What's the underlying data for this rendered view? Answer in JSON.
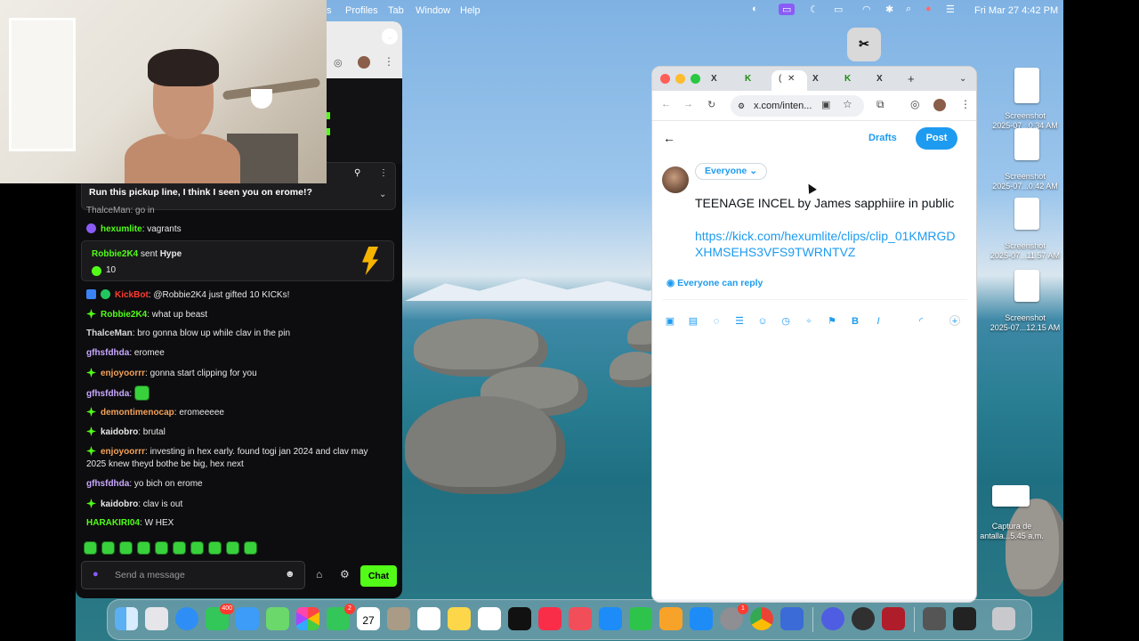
{
  "menubar": {
    "menus": [
      "s",
      "Profiles",
      "Tab",
      "Window",
      "Help"
    ],
    "datetime": "Fri Mar 27  4:42 PM"
  },
  "chat": {
    "pinned_message": "Run this pickup line, I think I seen you on erome!?",
    "partial_line": "ThalceMan: go in",
    "messages": [
      {
        "user": "hexumlite",
        "text": "vagrants",
        "color": "#53fc18"
      },
      {
        "user": "KickBot",
        "text": "@Robbie2K4 just gifted 10 KICKs!",
        "color": "#ff3b30"
      },
      {
        "user": "Robbie2K4",
        "text": "what up beast",
        "color": "#53fc18"
      },
      {
        "user": "ThalceMan",
        "text": "bro gonna blow up while clav in the pin",
        "color": "#d8d8d8"
      },
      {
        "user": "gfhsfdhda",
        "text": "eromee",
        "color": "#c8a8ff"
      },
      {
        "user": "enjoyoorrr",
        "text": "gonna start clipping for you",
        "color": "#f4a259"
      },
      {
        "user": "gfhsfdhda",
        "text": "",
        "color": "#c8a8ff"
      },
      {
        "user": "demontimenocap",
        "text": "eromeeeee",
        "color": "#f4a259"
      },
      {
        "user": "kaidobro",
        "text": "brutal",
        "color": "#e8e8e8"
      },
      {
        "user": "enjoyoorrr",
        "text": "investing in hex early. found togi jan 2024 and clav may",
        "color": "#f4a259"
      },
      {
        "user": "",
        "text": "2025 knew theyd bothe be big, hex next",
        "color": "#e8e8e8"
      },
      {
        "user": "gfhsfdhda",
        "text": "yo bich on erome",
        "color": "#c8a8ff"
      },
      {
        "user": "kaidobro",
        "text": "clav is out",
        "color": "#e8e8e8"
      },
      {
        "user": "HARAKIRI04",
        "text": "W HEX",
        "color": "#53fc18"
      }
    ],
    "hype": {
      "user": "Robbie2K4",
      "action": "sent",
      "item": "Hype",
      "count": "10"
    },
    "input_placeholder": "Send a message",
    "chat_button": "Chat"
  },
  "x_compose": {
    "tabs": [
      "X",
      "K",
      "(",
      "X",
      "K",
      "X"
    ],
    "active_tab": "(",
    "address": "x.com/inten...",
    "drafts_label": "Drafts",
    "post_label": "Post",
    "audience": "Everyone",
    "post_text": "TEENAGE INCEL by James sapphiire in public",
    "post_link": "https://kick.com/hexumlite/clips/clip_01KMRGDXHMSEHS3VFS9TWRNTVZ",
    "reply_setting": "Everyone can reply"
  },
  "desktop_files": [
    {
      "label1": "Screenshot",
      "label2": "2025-07...0.34 AM"
    },
    {
      "label1": "Screenshot",
      "label2": "2025-07...0.42 AM"
    },
    {
      "label1": "Screenshot",
      "label2": "2025-07...11.57 AM"
    },
    {
      "label1": "Screenshot",
      "label2": "2025-07...12.15 AM"
    },
    {
      "label1": "Captura de",
      "label2": "antalla...5.45 a.m."
    }
  ],
  "dock": {
    "badges": {
      "messages": "400",
      "facetime": "2",
      "settings": "1"
    },
    "calendar_day": "27"
  }
}
